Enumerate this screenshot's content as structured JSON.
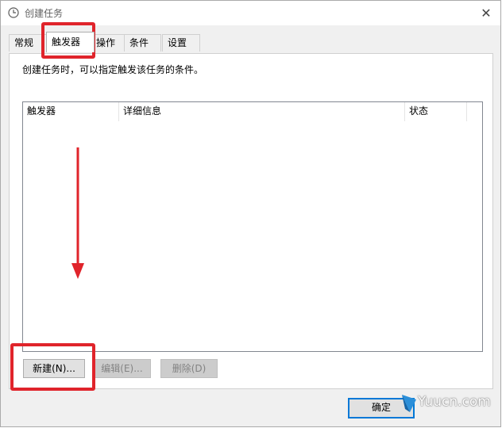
{
  "window": {
    "title": "创建任务",
    "title_icon": "clock-icon",
    "close_label": "✕"
  },
  "tabs": [
    {
      "label": "常规"
    },
    {
      "label": "触发器",
      "active": true
    },
    {
      "label": "操作"
    },
    {
      "label": "条件"
    },
    {
      "label": "设置"
    }
  ],
  "panel": {
    "description": "创建任务时，可以指定触发该任务的条件。",
    "columns": [
      "触发器",
      "详细信息",
      "状态"
    ]
  },
  "buttons": {
    "new_label": "新建(N)...",
    "edit_label": "编辑(E)...",
    "delete_label": "删除(D)",
    "ok_label": "确定"
  },
  "annotation": {
    "color": "#e0242b",
    "arrow": "down-arrow-icon"
  },
  "watermark": {
    "text": "Yuucn.com"
  },
  "colors": {
    "window_bg": "#f0f0f0",
    "primary_border": "#0078d7"
  }
}
